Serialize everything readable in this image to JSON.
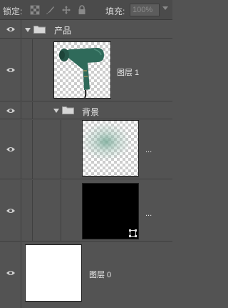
{
  "lockbar": {
    "lock_label": "锁定:",
    "lock_icons": [
      "lock-transparent-pixels-icon",
      "lock-image-pixels-icon",
      "lock-position-icon",
      "lock-all-icon"
    ],
    "fill_label": "填充:",
    "fill_value": "100%"
  },
  "layers": {
    "group_product": {
      "name": "产品"
    },
    "layer_1": {
      "name": "图层 1"
    },
    "group_background": {
      "name": "背景"
    },
    "layer_glow": {
      "more": "..."
    },
    "layer_black": {
      "more": "..."
    },
    "layer_0": {
      "name": "图层 0"
    }
  },
  "colors": {
    "panel_bg": "#535353",
    "divider": "#3f3f3f",
    "hair_dryer": "#2f6a5a",
    "glow": "#9ec4b6"
  }
}
